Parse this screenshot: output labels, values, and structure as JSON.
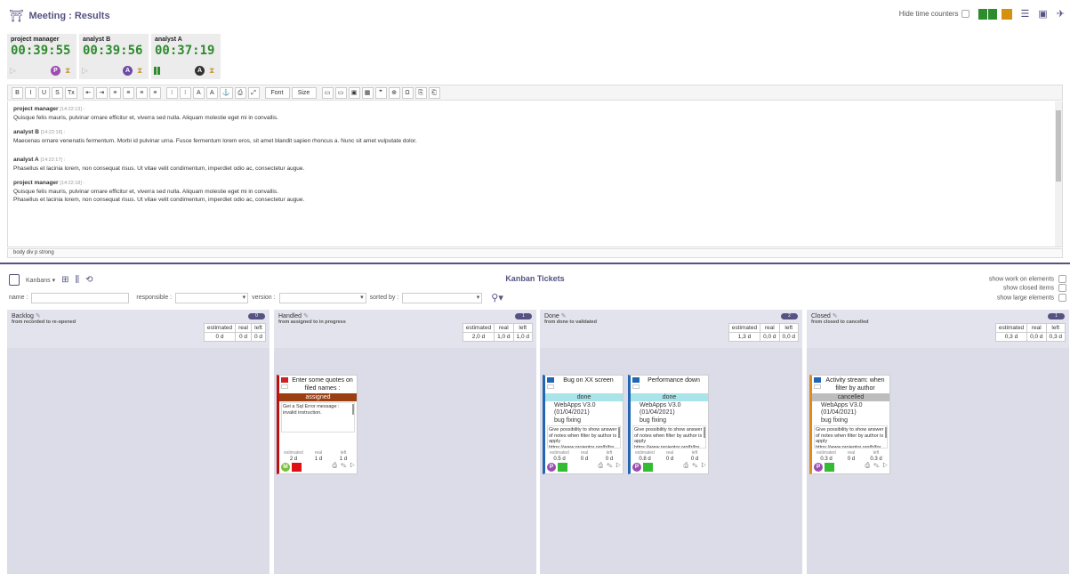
{
  "header": {
    "title": "Meeting : Results",
    "hide_label": "Hide time counters"
  },
  "counters": [
    {
      "who": "project manager",
      "time": "00:39:55",
      "avatar": "P",
      "avatar_color": "#9b4db0",
      "state": "stopped"
    },
    {
      "who": "analyst B",
      "time": "00:39:56",
      "avatar": "A",
      "avatar_color": "#6e4aa8",
      "state": "stopped"
    },
    {
      "who": "analyst A",
      "time": "00:37:19",
      "avatar": "A",
      "avatar_color": "#333333",
      "state": "running"
    }
  ],
  "toolbar": [
    "B",
    "I",
    "U",
    "S",
    "Tx",
    "⇤",
    "⇥",
    "≡",
    "≡",
    "≡",
    "≡",
    "⁝",
    "⁝",
    "A",
    "A",
    "⚓",
    "⎙",
    "⤢",
    "Font",
    "Size",
    "▭",
    "▭",
    "▣",
    "▦",
    "❞",
    "⊕",
    "Ω",
    "⎘",
    "⎗"
  ],
  "minutes": [
    {
      "author": "project manager",
      "time": "[14:22:13] :",
      "lines": [
        "Quisque felis mauris, pulvinar ornare efficitur et, viverra sed nulla. Aliquam molestie eget mi in convallis."
      ]
    },
    {
      "author": "analyst B",
      "time": "[14:22:16] :",
      "lines": [
        "Maecenas ornare venenatis fermentum. Morbi id pulvinar urna. Fusce fermentum lorem eros, sit amet blandit sapien rhoncus a. Nunc sit amet vulputate dolor."
      ]
    },
    {
      "author": "analyst A",
      "time": "[14:22:17] :",
      "lines": [
        "Phasellus et lacinia lorem, non consequat risus. Ut vitae velit condimentum, imperdiet odio ac, consectetur augue."
      ]
    },
    {
      "author": "project manager",
      "time": "[14:22:18] :",
      "lines": [
        "Quisque felis mauris, pulvinar ornare efficitur et, viverra sed nulla. Aliquam molestie eget mi in convallis.",
        "Phasellus et lacinia lorem, non consequat risus. Ut vitae velit condimentum, imperdiet odio ac, consectetur augue."
      ]
    }
  ],
  "pathbar": "body   div   p   strong",
  "kanban": {
    "title": "Kanban Tickets",
    "kanbans_label": "Kanbans",
    "name_label": "name :",
    "responsible_label": "responsible :",
    "version_label": "version :",
    "sorted_label": "sorted by :",
    "opts": [
      "show work on elements",
      "show closed items",
      "show large elements"
    ],
    "table_headers": [
      "estimated",
      "real",
      "left"
    ],
    "columns": [
      {
        "name": "Backlog",
        "sub": "from recorded to re-opened",
        "count": "0",
        "vals": [
          "0 d",
          "0 d",
          "0 d"
        ]
      },
      {
        "name": "Handled",
        "sub": "from assigned to in progress",
        "count": "1",
        "vals": [
          "2,0 d",
          "1,0 d",
          "1,0 d"
        ]
      },
      {
        "name": "Done",
        "sub": "from done to validated",
        "count": "2",
        "vals": [
          "1,3 d",
          "0,0 d",
          "0,0 d"
        ]
      },
      {
        "name": "Closed",
        "sub": "from closed to cancelled",
        "count": "1",
        "vals": [
          "0,3 d",
          "0,0 d",
          "0,3 d"
        ]
      }
    ],
    "cards": [
      {
        "title": "Enter some quotes on filed names :",
        "status": "assigned",
        "status_bg": "#9a3f12",
        "status_fg": "#ffffff",
        "version": "",
        "type": "",
        "desc": "Get a Sql Error message : invalid instruction.",
        "est": [
          "2 d",
          "1 d",
          "1 d"
        ],
        "avatar": "M",
        "avatar_color": "#7bbf3a",
        "sq": "#dd1111",
        "border": "#bb1111"
      },
      {
        "title": "Bug on XX screen",
        "status": "done",
        "status_bg": "#a8e4ea",
        "status_fg": "#333333",
        "version": "WebApps V3.0 (01/04/2021)",
        "type": "bug fixing",
        "desc": "Give possibility to show answer of notes when filter by author is apply https://www.projeqtor.org/fr/for",
        "est": [
          "0.5 d",
          "0 d",
          "0 d"
        ],
        "avatar": "P",
        "avatar_color": "#9b4db0",
        "sq": "#33bb33",
        "border": "#2166b3"
      },
      {
        "title": "Performance down",
        "status": "done",
        "status_bg": "#a8e4ea",
        "status_fg": "#333333",
        "version": "WebApps V3.0 (01/04/2021)",
        "type": "bug fixing",
        "desc": "Give possibility to show answer of notes when filter by author is apply https://www.projeqtor.org/fr/for",
        "est": [
          "0.8 d",
          "0 d",
          "0 d"
        ],
        "avatar": "P",
        "avatar_color": "#9b4db0",
        "sq": "#33bb33",
        "border": "#2166b3"
      },
      {
        "title": "Activity stream: when filter by author",
        "status": "cancelled",
        "status_bg": "#bdbdbd",
        "status_fg": "#333333",
        "version": "WebApps V3.0 (01/04/2021)",
        "type": "bug fixing",
        "desc": "Give possibility to show answer of notes when filter by author is apply https://www.projeqtor.org/fr/for",
        "est": [
          "0.3 d",
          "0 d",
          "0.3 d"
        ],
        "avatar": "P",
        "avatar_color": "#9b4db0",
        "sq": "#33bb33",
        "border": "#e08a1e"
      }
    ],
    "est_labels": [
      "estimated",
      "real",
      "left"
    ]
  }
}
